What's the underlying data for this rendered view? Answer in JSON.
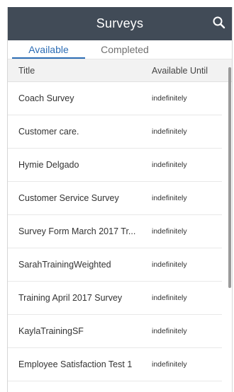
{
  "header": {
    "title": "Surveys",
    "search_icon": "search-icon"
  },
  "tabs": [
    {
      "label": "Available",
      "active": true
    },
    {
      "label": "Completed",
      "active": false
    }
  ],
  "table": {
    "columns": [
      "Title",
      "Available Until"
    ],
    "rows": [
      {
        "title": "Coach Survey",
        "until": "indefinitely"
      },
      {
        "title": "Customer care.",
        "until": "indefinitely"
      },
      {
        "title": "Hymie Delgado",
        "until": "indefinitely"
      },
      {
        "title": "Customer Service Survey",
        "until": "indefinitely"
      },
      {
        "title": "Survey Form March 2017 Tr...",
        "until": "indefinitely"
      },
      {
        "title": "SarahTrainingWeighted",
        "until": "indefinitely"
      },
      {
        "title": "Training April 2017 Survey",
        "until": "indefinitely"
      },
      {
        "title": "KaylaTrainingSF",
        "until": "indefinitely"
      },
      {
        "title": "Employee Satisfaction Test 1",
        "until": "indefinitely"
      }
    ]
  },
  "colors": {
    "header_bg": "#414b57",
    "accent": "#2d6db5"
  }
}
